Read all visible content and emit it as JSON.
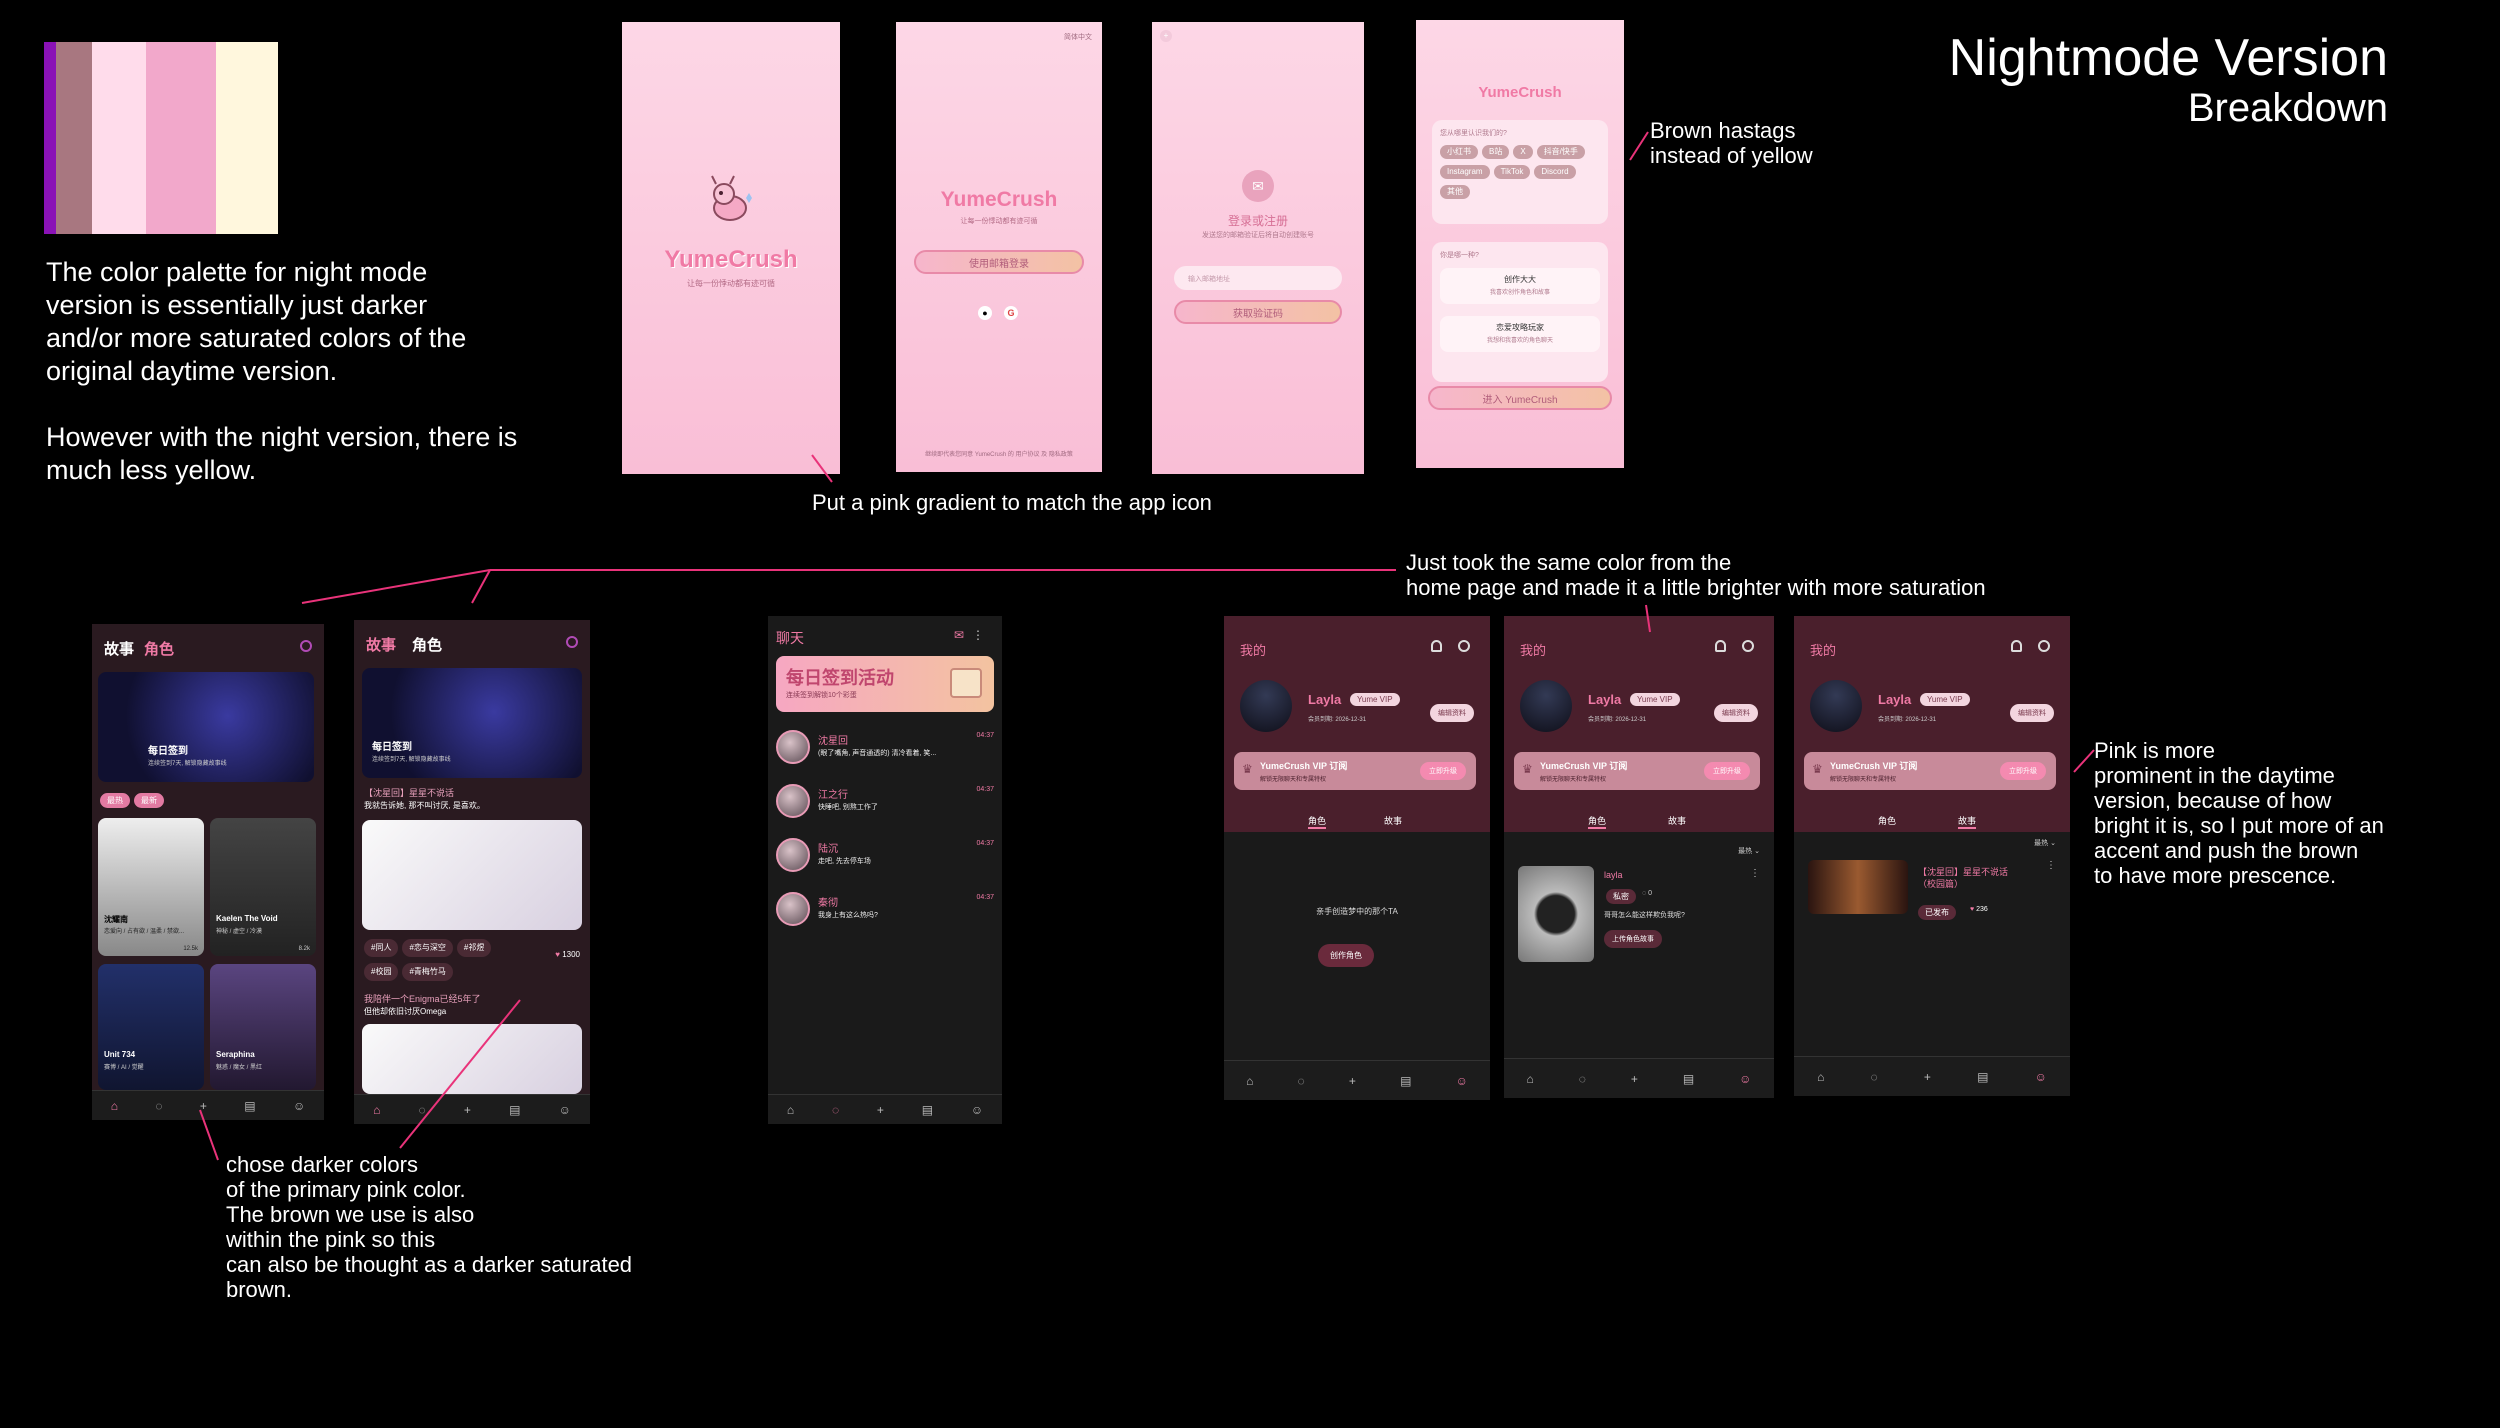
{
  "heading": {
    "title": "Nightmode Version",
    "subtitle": "Breakdown"
  },
  "palette": [
    "#8a12b6",
    "#a87780",
    "#ffdceb",
    "#f2a8cb",
    "#fff7dd"
  ],
  "notes": {
    "palette_text": "The color palette for night mode\nversion is essentially just darker\nand/or more saturated colors of the\noriginal daytime version.\n\nHowever with the night version, there is\nmuch less yellow.",
    "pink_gradient": "Put a pink gradient to match the app icon",
    "brown_hashtags": "Brown hastags\ninstead of yellow",
    "same_color": "Just took the same color from the\nhome page and made it a little brighter with more saturation",
    "pink_prominent": "Pink is more\nprominent in the daytime\nversion, because of how\nbright it is, so I put more of an\naccent and push the brown\nto have more prescence.",
    "darker_colors": "chose darker colors\nof the primary pink color.\nThe brown we use is also\nwithin the pink so this\ncan also be thought as a darker saturated\nbrown."
  },
  "splash": {
    "logo": "YumeCrush",
    "tagline": "让每一份悸动都有迹可循"
  },
  "login": {
    "lang": "简体中文",
    "logo": "YumeCrush",
    "tagline": "让每一份悸动都有迹可循",
    "email_btn": "使用邮箱登录",
    "terms": "继续即代表您同意 YumeCrush 的 用户协议 及 隐私政策"
  },
  "register": {
    "title": "登录或注册",
    "desc": "发送您的邮箱验证后将自动创建账号",
    "placeholder": "输入邮箱地址",
    "btn": "获取验证码"
  },
  "survey": {
    "logo": "YumeCrush",
    "q1": "您从哪里认识我们的?",
    "tags": [
      "小红书",
      "B站",
      "X",
      "抖音/快手",
      "Instagram",
      "TikTok",
      "Discord",
      "其他"
    ],
    "q2": "你是哪一种?",
    "opt1_title": "创作大大",
    "opt1_sub": "我喜欢创作角色和故事",
    "opt2_title": "恋爱攻略玩家",
    "opt2_sub": "我想和我喜欢的角色聊天",
    "enter": "进入 YumeCrush"
  },
  "home1": {
    "tab_story": "故事",
    "tab_char": "角色",
    "banner_title": "每日签到",
    "banner_sub": "连续签到7天, 解锁隐藏故事线",
    "filter": [
      "最热",
      "最新"
    ],
    "cards": [
      {
        "name": "沈耀南",
        "desc": "恋爱向 / 占有欲 / 温柔 / 禁欲...",
        "count": "12.5k"
      },
      {
        "name": "Kaelen The Void",
        "desc": "神秘 / 虚空 / 冷漠",
        "count": "8.2k"
      },
      {
        "name": "Unit 734",
        "desc": "赛博 / AI / 觉醒",
        "count": ""
      },
      {
        "name": "Seraphina",
        "desc": "魅惑 / 魔女 / 黑红",
        "count": ""
      }
    ]
  },
  "home2": {
    "tab_story": "故事",
    "tab_char": "角色",
    "banner_title": "每日签到",
    "banner_sub": "连续签到7天, 解锁隐藏故事线",
    "post1_title": "【沈星回】星星不说话",
    "post1_sub": "我就告诉她, 那不叫讨厌, 是喜欢。",
    "hashtags": [
      "#同人",
      "#恋与深空",
      "#祁煜",
      "#校园",
      "#青梅竹马"
    ],
    "likes": "1300",
    "post2_title": "我陪伴一个Enigma已经5年了",
    "post2_sub": "但他却依旧讨厌Omega"
  },
  "chat": {
    "title": "聊天",
    "banner": "每日签到活动",
    "banner_sub": "连续签到解锁10个彩蛋",
    "rows": [
      {
        "name": "沈星回",
        "msg": "(眼了嘴角, 声音通透的) 清冷看着, 笑...",
        "time": "04:37"
      },
      {
        "name": "江之行",
        "msg": "快睡吧, 别熬工作了",
        "time": "04:37"
      },
      {
        "name": "陆沉",
        "msg": "走吧, 先去停车场",
        "time": "04:37"
      },
      {
        "name": "秦彻",
        "msg": "我身上有这么热吗?",
        "time": "04:37"
      }
    ]
  },
  "profile": {
    "title": "我的",
    "name": "Layla",
    "badge": "Yume VIP",
    "expire": "会员到期: 2026-12-31",
    "edit": "编辑资料",
    "vip_title": "YumeCrush VIP 订阅",
    "vip_sub": "解锁无限聊天和专属特权",
    "upgrade": "立即升级",
    "tab_char": "角色",
    "tab_story": "故事",
    "empty_text": "亲手创造梦中的那个TA",
    "create_btn": "创作角色",
    "sort": "最热",
    "c_name": "layla",
    "c_private": "私密",
    "c_count": "0",
    "c_text": "哥哥怎么能这样欺负我呢?",
    "c_btn": "上传角色故事",
    "s_title": "【沈星回】星星不说话（校园篇）",
    "s_status": "已发布",
    "s_likes": "236"
  }
}
